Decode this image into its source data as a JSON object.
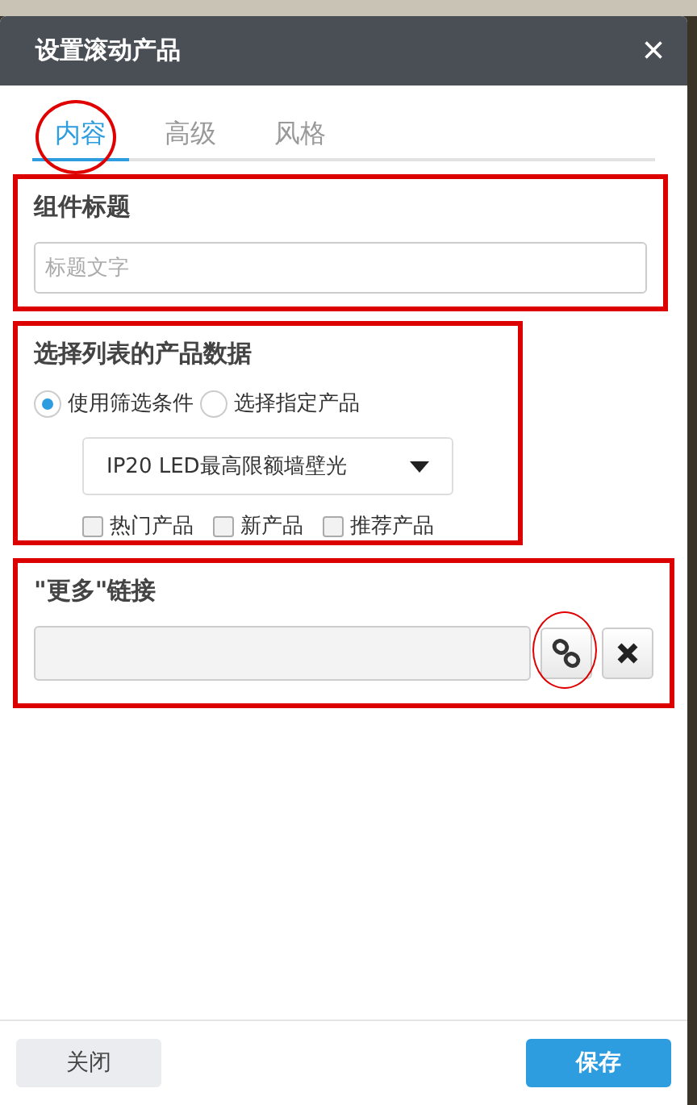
{
  "dialog": {
    "title": "设置滚动产品",
    "close": "×"
  },
  "tabs": [
    {
      "label": "内容",
      "selected": true,
      "circled": true
    },
    {
      "label": "高级",
      "selected": false,
      "circled": false
    },
    {
      "label": "风格",
      "selected": false,
      "circled": false
    }
  ],
  "title_section": {
    "heading": "组件标题",
    "placeholder": "标题文字"
  },
  "data_section": {
    "heading": "选择列表的产品数据",
    "radios": [
      {
        "label": "使用筛选条件",
        "selected": true
      },
      {
        "label": "选择指定产品",
        "selected": false
      }
    ],
    "dropdown": {
      "value": "IP20 LED最高限额墙壁光"
    },
    "checkboxes": [
      {
        "label": "热门产品",
        "checked": false
      },
      {
        "label": "新产品",
        "checked": false
      },
      {
        "label": "推荐产品",
        "checked": false
      }
    ]
  },
  "link_section": {
    "heading": "\"更多\"链接",
    "link_circled": true
  },
  "footer": {
    "close": "关闭",
    "save": "保存"
  }
}
